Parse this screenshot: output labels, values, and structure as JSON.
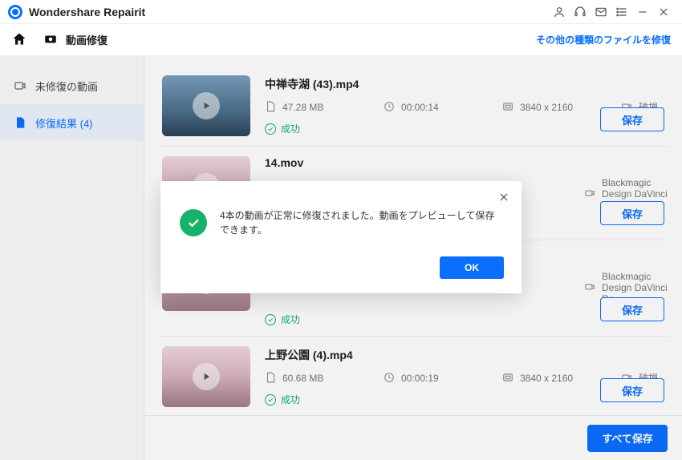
{
  "app": {
    "title": "Wondershare Repairit"
  },
  "toolbar": {
    "section_label": "動画修復",
    "other_types_link": "その他の種類のファイルを修復"
  },
  "sidebar": {
    "items": [
      {
        "label": "未修復の動画"
      },
      {
        "label": "修復結果 (4)"
      }
    ]
  },
  "videos": [
    {
      "name": "中禅寺湖 (43).mp4",
      "size": "47.28  MB",
      "duration": "00:00:14",
      "resolution": "3840 x 2160",
      "source": "破損",
      "status": "成功",
      "save_label": "保存",
      "thumb": "lake"
    },
    {
      "name": "14.mov",
      "size": "",
      "duration": "",
      "resolution": "",
      "source": "Blackmagic Design DaVinci Re...",
      "status": "",
      "save_label": "保存",
      "thumb": "blossom"
    },
    {
      "name": "",
      "size": "",
      "duration": "",
      "resolution": "",
      "source": "Blackmagic Design DaVinci Re...",
      "status": "成功",
      "save_label": "保存",
      "thumb": "blossom"
    },
    {
      "name": "上野公園 (4).mp4",
      "size": "60.68  MB",
      "duration": "00:00:19",
      "resolution": "3840 x 2160",
      "source": "破損",
      "status": "成功",
      "save_label": "保存",
      "thumb": "blossom"
    }
  ],
  "footer": {
    "save_all": "すべて保存"
  },
  "modal": {
    "message": "4本の動画が正常に修復されました。動画をプレビューして保存できます。",
    "ok": "OK"
  }
}
